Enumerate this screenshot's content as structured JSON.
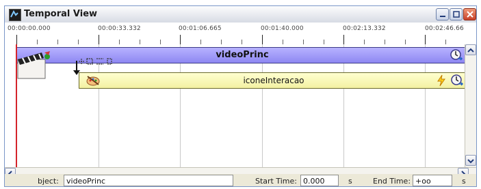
{
  "window": {
    "title": "Temporal View"
  },
  "ruler": {
    "ticks": [
      "00:00:00.000",
      "00:00:33.332",
      "00:01:06.665",
      "00:01:40.000",
      "00:02:13.332",
      "00:02:46.66"
    ]
  },
  "timeline": {
    "tracks": [
      {
        "name": "videoPrinc"
      },
      {
        "name": "iconeInteracao"
      }
    ]
  },
  "status": {
    "object_label": "bject:",
    "object_value": "videoPrinc",
    "start_label": "Start Time:",
    "start_value": "0.000",
    "start_unit": "s",
    "end_label": "End Time:",
    "end_value": "+oo",
    "end_unit": "s"
  },
  "icons": [
    "app-icon",
    "minimize-icon",
    "maximize-icon",
    "close-icon",
    "media-clapper-icon",
    "connector-icon",
    "clock-icon",
    "palette-icon",
    "lightning-icon",
    "scroll-left-icon",
    "scroll-right-icon",
    "scroll-up-icon",
    "scroll-down-icon"
  ]
}
